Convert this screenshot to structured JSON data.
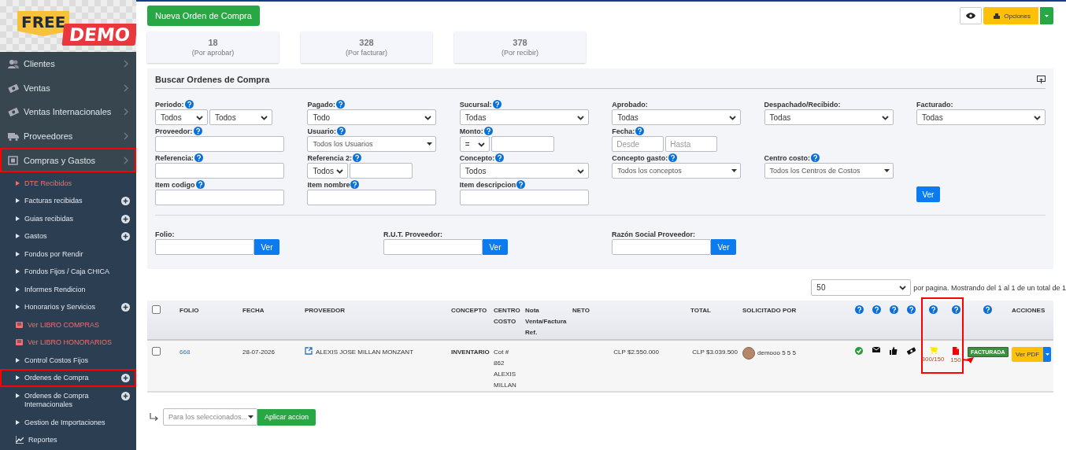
{
  "logo": {
    "word_1": "FREE",
    "word_2": "DEMO"
  },
  "sidebar": {
    "items": [
      {
        "label": "Clientes",
        "highlighted": false
      },
      {
        "label": "Ventas",
        "highlighted": false
      },
      {
        "label": "Ventas Internacionales",
        "highlighted": false
      },
      {
        "label": "Proveedores",
        "highlighted": false
      },
      {
        "label": "Compras y Gastos",
        "highlighted": true
      }
    ],
    "submenu": [
      {
        "label": "DTE Recibidos",
        "kind": "red-item",
        "has_add": false,
        "highlighted": false
      },
      {
        "label": "Facturas recibidas",
        "kind": "item",
        "has_add": true,
        "highlighted": false
      },
      {
        "label": "Guias recibidas",
        "kind": "item",
        "has_add": true,
        "highlighted": false
      },
      {
        "label": "Gastos",
        "kind": "item",
        "has_add": true,
        "highlighted": false
      },
      {
        "label": "Fondos por Rendir",
        "kind": "item",
        "has_add": false,
        "highlighted": false
      },
      {
        "label": "Fondos Fijos / Caja CHICA",
        "kind": "item",
        "has_add": false,
        "highlighted": false
      },
      {
        "label": "Informes Rendicion",
        "kind": "item",
        "has_add": false,
        "highlighted": false
      },
      {
        "label": "Honorarios y Servicios",
        "kind": "item",
        "has_add": true,
        "highlighted": false
      },
      {
        "label": "Ver LIBRO COMPRAS",
        "kind": "book",
        "has_add": false,
        "highlighted": false
      },
      {
        "label": "Ver LIBRO HONORARIOS",
        "kind": "book",
        "has_add": false,
        "highlighted": false
      },
      {
        "label": "Control Costos Fijos",
        "kind": "item",
        "has_add": false,
        "highlighted": false
      },
      {
        "label": "Ordenes de Compra",
        "kind": "item",
        "has_add": true,
        "highlighted": true
      },
      {
        "label": "Ordenes de Compra Internacionales",
        "kind": "item",
        "has_add": true,
        "highlighted": false
      },
      {
        "label": "Gestion de Importaciones",
        "kind": "item",
        "has_add": false,
        "highlighted": false
      },
      {
        "label": "Reportes",
        "kind": "chart",
        "has_add": false,
        "highlighted": false
      }
    ]
  },
  "toolbar": {
    "new_button": "Nueva Orden de Compra",
    "options_button": "Opciones"
  },
  "stats": [
    {
      "value": "18",
      "label": "(Por aprobar)"
    },
    {
      "value": "328",
      "label": "(Por facturar)"
    },
    {
      "value": "378",
      "label": "(Por recibir)"
    }
  ],
  "search": {
    "title": "Buscar Ordenes de Compra",
    "rows": [
      [
        {
          "label": "Periodo:",
          "help": true,
          "controls": [
            {
              "kind": "select",
              "value": "Todos"
            },
            {
              "kind": "select",
              "value": "Todos"
            }
          ]
        },
        {
          "label": "Pagado:",
          "help": true,
          "controls": [
            {
              "kind": "select",
              "value": "Todo"
            }
          ]
        },
        {
          "label": "Sucursal:",
          "help": true,
          "controls": [
            {
              "kind": "select",
              "value": "Todas"
            }
          ]
        },
        {
          "label": "Aprobado:",
          "help": false,
          "controls": [
            {
              "kind": "select",
              "value": "Todas"
            }
          ]
        },
        {
          "label": "Despachado/Recibido:",
          "help": false,
          "controls": [
            {
              "kind": "select",
              "value": "Todas"
            }
          ]
        },
        {
          "label": "Facturado:",
          "help": false,
          "controls": [
            {
              "kind": "select",
              "value": "Todas"
            }
          ]
        }
      ],
      [
        {
          "label": "Proveedor:",
          "help": true,
          "controls": [
            {
              "kind": "input"
            }
          ]
        },
        {
          "label": "Usuario:",
          "help": true,
          "controls": [
            {
              "kind": "dropdown",
              "value": "Todos los Usuarios"
            }
          ]
        },
        {
          "label": "Monto:",
          "help": true,
          "controls": [
            {
              "kind": "select",
              "value": "="
            },
            {
              "kind": "input"
            }
          ]
        },
        {
          "label": "Fecha:",
          "help": true,
          "controls": [
            {
              "kind": "input",
              "placeholder": "Desde"
            },
            {
              "kind": "input",
              "placeholder": "Hasta"
            }
          ]
        },
        null,
        null
      ],
      [
        {
          "label": "Referencia:",
          "help": true,
          "controls": [
            {
              "kind": "input"
            }
          ]
        },
        {
          "label": "Referencia 2:",
          "help": true,
          "controls": [
            {
              "kind": "select",
              "value": "Todos"
            },
            {
              "kind": "input"
            }
          ]
        },
        {
          "label": "Concepto:",
          "help": true,
          "controls": [
            {
              "kind": "select",
              "value": "Todos"
            }
          ]
        },
        {
          "label": "Concepto gasto:",
          "help": true,
          "controls": [
            {
              "kind": "dropdown",
              "value": "Todos los conceptos"
            }
          ]
        },
        {
          "label": "Centro costo:",
          "help": true,
          "controls": [
            {
              "kind": "dropdown",
              "value": "Todos los Centros de Costos"
            }
          ]
        },
        null
      ],
      [
        {
          "label": "Item codigo",
          "help": true,
          "controls": [
            {
              "kind": "input"
            }
          ]
        },
        {
          "label": "Item nombre",
          "help": true,
          "controls": [
            {
              "kind": "input"
            }
          ]
        },
        {
          "label": "Item descripcion",
          "help": true,
          "controls": [
            {
              "kind": "input"
            }
          ]
        },
        null,
        null,
        {
          "controls": [
            {
              "kind": "button",
              "label": "Ver"
            }
          ]
        }
      ]
    ],
    "quick": [
      {
        "label": "Folio:",
        "button": "Ver"
      },
      {
        "label": "R.U.T. Proveedor:",
        "button": "Ver"
      },
      {
        "label": "Razón Social Proveedor:",
        "button": "Ver"
      }
    ]
  },
  "pagination": {
    "per_page": "50",
    "summary": "por pagina. Mostrando del 1 al 1 de un total de 1"
  },
  "table": {
    "columns": [
      {
        "kind": "checkbox",
        "checked": false
      },
      {
        "kind": "text",
        "label": "FOLIO"
      },
      {
        "kind": "text",
        "label": "FECHA"
      },
      {
        "kind": "text",
        "label": "PROVEEDOR"
      },
      {
        "kind": "text",
        "label": "CONCEPTO"
      },
      {
        "kind": "text",
        "label": "CENTRO COSTO"
      },
      {
        "kind": "text",
        "label": "Nota Venta/Factura Ref."
      },
      {
        "kind": "text",
        "label": "NETO"
      },
      {
        "kind": "text",
        "label": "TOTAL"
      },
      {
        "kind": "text",
        "label": "SOLICITADO POR"
      },
      {
        "kind": "help",
        "highlighted": false
      },
      {
        "kind": "help",
        "highlighted": false
      },
      {
        "kind": "help",
        "highlighted": false
      },
      {
        "kind": "help",
        "highlighted": false
      },
      {
        "kind": "help",
        "highlighted": true
      },
      {
        "kind": "help",
        "highlighted": true
      },
      {
        "kind": "help",
        "highlighted": false
      },
      {
        "kind": "text",
        "label": "ACCIONES"
      }
    ],
    "rows": [
      {
        "checked": false,
        "folio": "668",
        "fecha": "28-07-2026",
        "proveedor": "ALEXIS JOSE MILLAN MONZANT",
        "concepto": "INVENTARIO",
        "centro_costo": "Cot # 862 ALEXIS MILLAN",
        "neto": "CLP $2.550.000",
        "total": "CLP $3.039.500",
        "solicitado_por": "demooo 5 5 5",
        "status_icons": [
          {
            "kind": "check"
          },
          {
            "kind": "mail"
          },
          {
            "kind": "like"
          },
          {
            "kind": "money"
          }
        ],
        "received": "300/150",
        "invoiced": "150",
        "status": "FACTURADA",
        "status_arrow": true,
        "action": "Ver PDF"
      }
    ]
  },
  "bulk": {
    "placeholder": "Para los seleccionados...",
    "button": "Aplicar accion"
  }
}
